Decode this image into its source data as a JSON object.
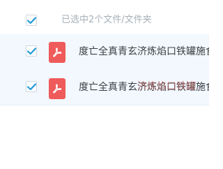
{
  "header": {
    "selected_label": "已选中2个文件/文件夹",
    "select_all_checked": true
  },
  "files": [
    {
      "name": "度亡全真青玄济炼焰口铁罐施食",
      "type_icon": "pdf-icon",
      "checked": true
    },
    {
      "name": "度亡全真青玄济炼焰口铁罐施食",
      "type_icon": "pdf-icon",
      "checked": true
    }
  ],
  "watermark": {
    "text": "济炼焰口铁罐"
  },
  "colors": {
    "accent": "#1f9ad6",
    "pdf_red": "#ef5a5a",
    "row_selected_bg": "#f2f8fd"
  }
}
